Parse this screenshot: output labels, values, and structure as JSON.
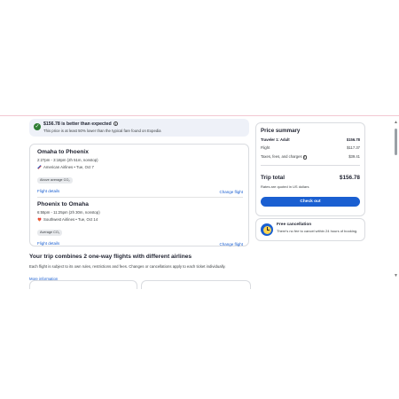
{
  "banner": {
    "title": "$156.78 is better than expected",
    "subtitle": "This price is at least 50% lower than the typical fare found on Expedia",
    "info_icon": "info-icon",
    "check_icon": "check-circle-icon",
    "check_color": "#2e7d32"
  },
  "legs": [
    {
      "title": "Omaha to Phoenix",
      "time": "2:27pm - 3:18pm (2h 51m, nonstop)",
      "airline": "American Airlines • Tue, Oct 7",
      "co2": "Above average CO₂",
      "details_link": "Flight details",
      "change_link": "Change flight"
    },
    {
      "title": "Phoenix to Omaha",
      "time": "6:55pm - 11:25pm (2h 30m, nonstop)",
      "airline": "Southwest Airlines • Tue, Oct 14",
      "co2": "Average CO₂",
      "details_link": "Flight details",
      "change_link": "Change flight"
    }
  ],
  "combine": {
    "title": "Your trip combines 2 one-way flights with different airlines",
    "description": "Each flight is subject to its own rules, restrictions and fees. Changes or cancellations apply to each ticket individually.",
    "link": "More information"
  },
  "price_summary": {
    "title": "Price summary",
    "traveler_label": "Traveler 1: Adult",
    "traveler_amount": "$156.78",
    "flight_label": "Flight",
    "flight_amount": "$117.37",
    "taxes_label": "Taxes, fees, and charges",
    "taxes_amount": "$39.41",
    "total_label": "Trip total",
    "total_amount": "$156.78",
    "note": "Rates are quoted in US dollars",
    "checkout_label": "Check out"
  },
  "free_cancellation": {
    "title": "Free cancellation",
    "subtitle": "There's no fee to cancel within 24 hours of booking.",
    "icon": "clock-icon"
  },
  "colors": {
    "accent": "#1a5fd1",
    "banner_bg": "#eef1f8"
  }
}
